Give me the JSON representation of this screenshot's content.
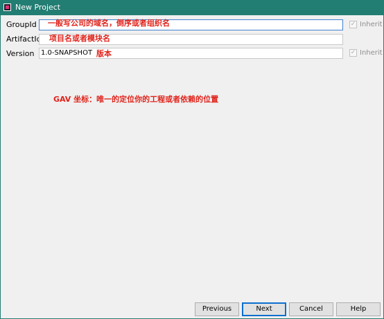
{
  "window": {
    "title": "New Project",
    "app_icon": "intellij-idea-icon"
  },
  "form": {
    "group_id": {
      "label": "GroupId",
      "value": "",
      "annotation": "一般写公司的域名，倒序或者组织名",
      "inherit_label": "Inherit",
      "inherit_checked": true
    },
    "artifact_id": {
      "label": "ArtifactId",
      "value": "",
      "annotation": "项目名或者模块名"
    },
    "version": {
      "label": "Version",
      "value": "1.0-SNAPSHOT",
      "annotation": "版本",
      "inherit_label": "Inherit",
      "inherit_checked": true
    }
  },
  "note": "GAV 坐标：唯一的定位你的工程或者依赖的位置",
  "buttons": {
    "previous": "Previous",
    "next": "Next",
    "cancel": "Cancel",
    "help": "Help"
  },
  "colors": {
    "titlebar": "#227d73",
    "annotation": "#e0231b",
    "focus_border": "#3f82d0",
    "default_button_border": "#0a6fcf"
  }
}
